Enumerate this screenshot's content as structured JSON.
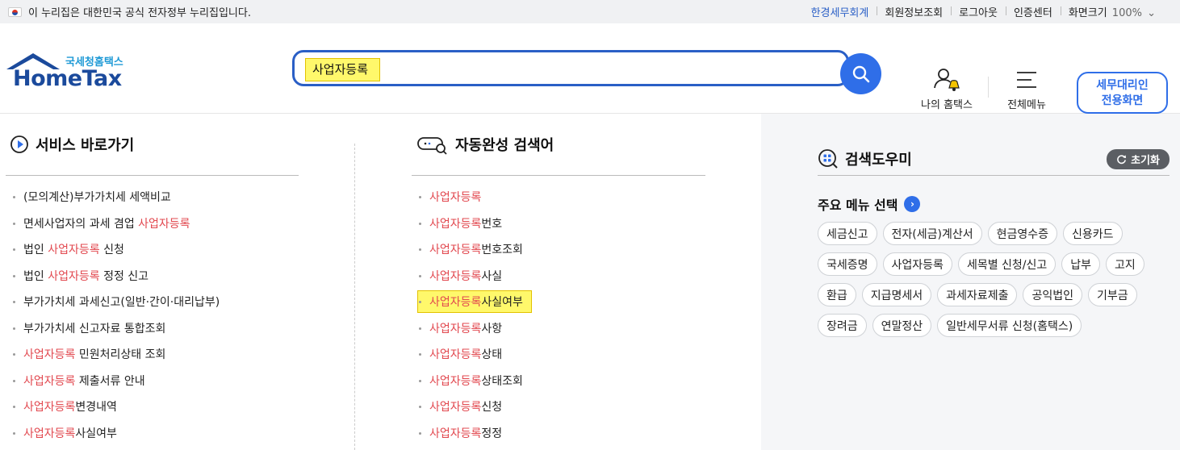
{
  "govbar": {
    "notice": "이 누리집은 대한민국 공식 전자정부 누리집입니다.",
    "links": [
      "한경세무회계",
      "회원정보조회",
      "로그아웃",
      "인증센터",
      "화면크기"
    ],
    "zoom": "100%"
  },
  "logo": {
    "small": "국세청홈택스",
    "big": "HomeTax"
  },
  "search": {
    "query": "사업자등록"
  },
  "header": {
    "my_hometax": "나의 홈택스",
    "all_menu": "전체메뉴",
    "agent_line1": "세무대리인",
    "agent_line2": "전용화면"
  },
  "shortcuts": {
    "title": "서비스 바로가기",
    "items": [
      {
        "pre": "(모의계산)부가가치세 세액비교",
        "kw": "",
        "post": ""
      },
      {
        "pre": "면세사업자의 과세 겸업 ",
        "kw": "사업자등록",
        "post": ""
      },
      {
        "pre": "법인 ",
        "kw": "사업자등록",
        "post": " 신청"
      },
      {
        "pre": "법인 ",
        "kw": "사업자등록",
        "post": " 정정 신고"
      },
      {
        "pre": "부가가치세 과세신고(일반·간이·대리납부)",
        "kw": "",
        "post": ""
      },
      {
        "pre": "부가가치세 신고자료 통합조회",
        "kw": "",
        "post": ""
      },
      {
        "pre": "",
        "kw": "사업자등록",
        "post": " 민원처리상태 조회"
      },
      {
        "pre": "",
        "kw": "사업자등록",
        "post": " 제출서류 안내"
      },
      {
        "pre": "",
        "kw": "사업자등록",
        "post": "변경내역"
      },
      {
        "pre": "",
        "kw": "사업자등록",
        "post": "사실여부"
      }
    ]
  },
  "autocomplete": {
    "title": "자동완성 검색어",
    "keyword": "사업자등록",
    "suffixes": [
      "",
      "번호",
      "번호조회",
      "사실",
      "사실여부",
      "사항",
      "상태",
      "상태조회",
      "신청",
      "정정"
    ],
    "selected_index": 4
  },
  "helper": {
    "title": "검색도우미",
    "reset": "초기화",
    "major_title": "주요 메뉴 선택",
    "chips": [
      "세금신고",
      "전자(세금)계산서",
      "현금영수증",
      "신용카드",
      "국세증명",
      "사업자등록",
      "세목별 신청/신고",
      "납부",
      "고지",
      "환급",
      "지급명세서",
      "과세자료제출",
      "공익법인",
      "기부금",
      "장려금",
      "연말정산",
      "일반세무서류 신청(홈택스)"
    ]
  },
  "colors": {
    "accent": "#2f6ee8",
    "keyword": "#e2484f",
    "highlight": "#fff86b"
  }
}
